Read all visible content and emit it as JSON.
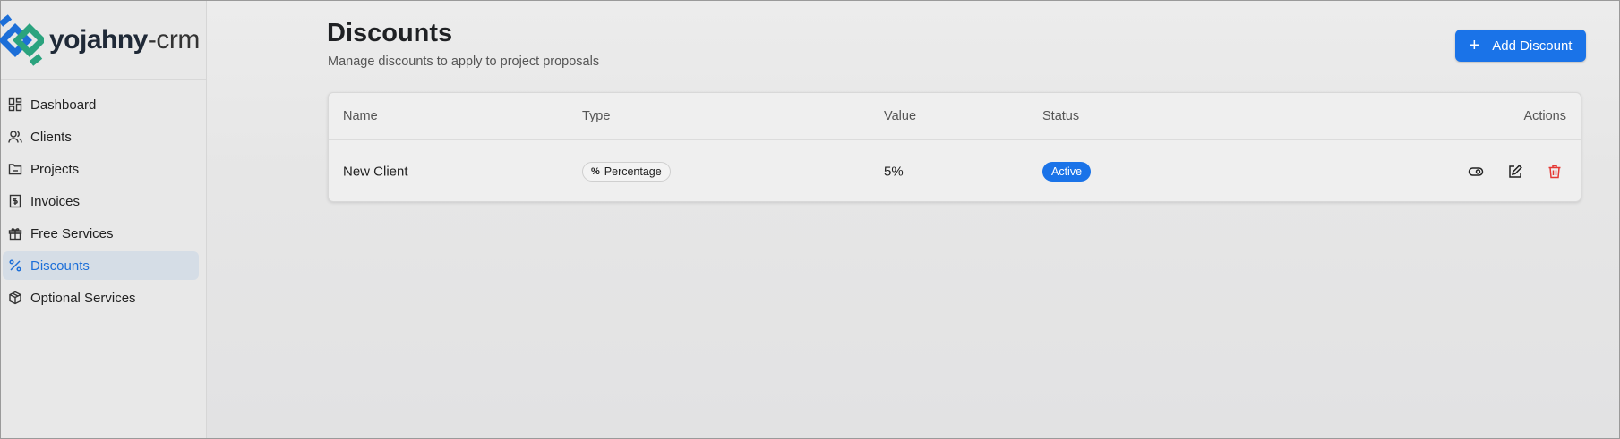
{
  "brand": {
    "name_bold": "yojahny",
    "name_suffix": "-crm"
  },
  "sidebar": {
    "items": [
      {
        "label": "Dashboard",
        "icon": "dashboard-icon"
      },
      {
        "label": "Clients",
        "icon": "users-icon"
      },
      {
        "label": "Projects",
        "icon": "folder-icon"
      },
      {
        "label": "Invoices",
        "icon": "invoice-icon"
      },
      {
        "label": "Free Services",
        "icon": "gift-icon"
      },
      {
        "label": "Discounts",
        "icon": "percent-icon",
        "active": true
      },
      {
        "label": "Optional Services",
        "icon": "package-icon"
      }
    ]
  },
  "page": {
    "title": "Discounts",
    "subtitle": "Manage discounts to apply to project proposals",
    "add_button_label": "Add Discount"
  },
  "table": {
    "headers": {
      "name": "Name",
      "type": "Type",
      "value": "Value",
      "status": "Status",
      "actions": "Actions"
    },
    "rows": [
      {
        "name": "New Client",
        "type": "Percentage",
        "type_symbol": "%",
        "value": "5%",
        "status": "Active"
      }
    ]
  },
  "colors": {
    "accent": "#1a73e8",
    "danger": "#e53935",
    "active_nav_bg": "#d5dde6"
  }
}
